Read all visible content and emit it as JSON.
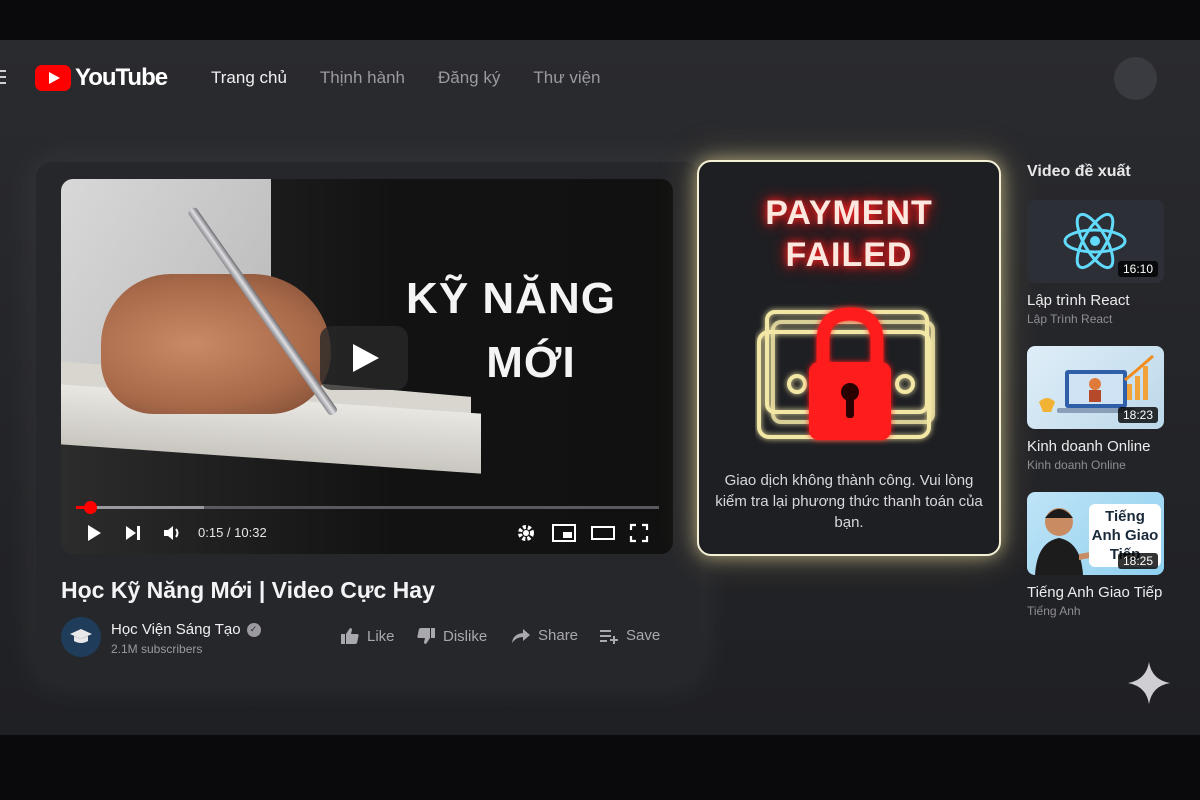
{
  "app": {
    "logo_text": "YouTube",
    "logo_icon": "youtube-play-icon",
    "brand_color": "#ff0000"
  },
  "nav": {
    "items": [
      {
        "label": "Trang chủ",
        "active": true
      },
      {
        "label": "Thịnh hành",
        "active": false
      },
      {
        "label": "Đăng ký",
        "active": false
      },
      {
        "label": "Thư viện",
        "active": false
      }
    ]
  },
  "player": {
    "thumbnail_text_line1": "KỸ NĂNG",
    "thumbnail_text_line2": "MỚI",
    "time": "0:15 / 10:32",
    "progress_fraction": 0.024,
    "buffered_fraction": 0.22,
    "controls": [
      "play-icon",
      "next-icon",
      "volume-icon",
      "settings-icon",
      "miniplayer-icon",
      "theater-icon",
      "fullscreen-icon"
    ]
  },
  "video": {
    "title": "Học Kỹ Năng Mới | Video Cực Hay",
    "channel": "Học Viện Sáng Tạo",
    "subscribers": "2.1M subscribers",
    "actions": {
      "like": "Like",
      "dislike": "Dislike",
      "share": "Share",
      "save": "Save"
    }
  },
  "payment": {
    "title_line1": "PAYMENT",
    "title_line2": "FAILED",
    "message": "Giao dịch không thành công. Vui lòng kiểm tra lại phương thức thanh toán của bạn.",
    "accent_color": "#ff1a1a",
    "glow_color": "#f3e9b0"
  },
  "sidebar": {
    "heading": "Video đề xuất",
    "items": [
      {
        "title": "Lập trình React",
        "channel": "Lập Trình React",
        "duration": "16:10",
        "thumb_icon": "react-logo-icon"
      },
      {
        "title": "Kinh doanh Online",
        "channel": "Kinh doanh Online",
        "duration": "18:23",
        "thumb_icon": "laptop-chart-icon"
      },
      {
        "title": "Tiếng Anh Giao Tiếp",
        "channel": "Tiếng Anh",
        "duration": "18:25",
        "thumb_text": "Tiếng Anh Giao Tiếp"
      }
    ]
  }
}
